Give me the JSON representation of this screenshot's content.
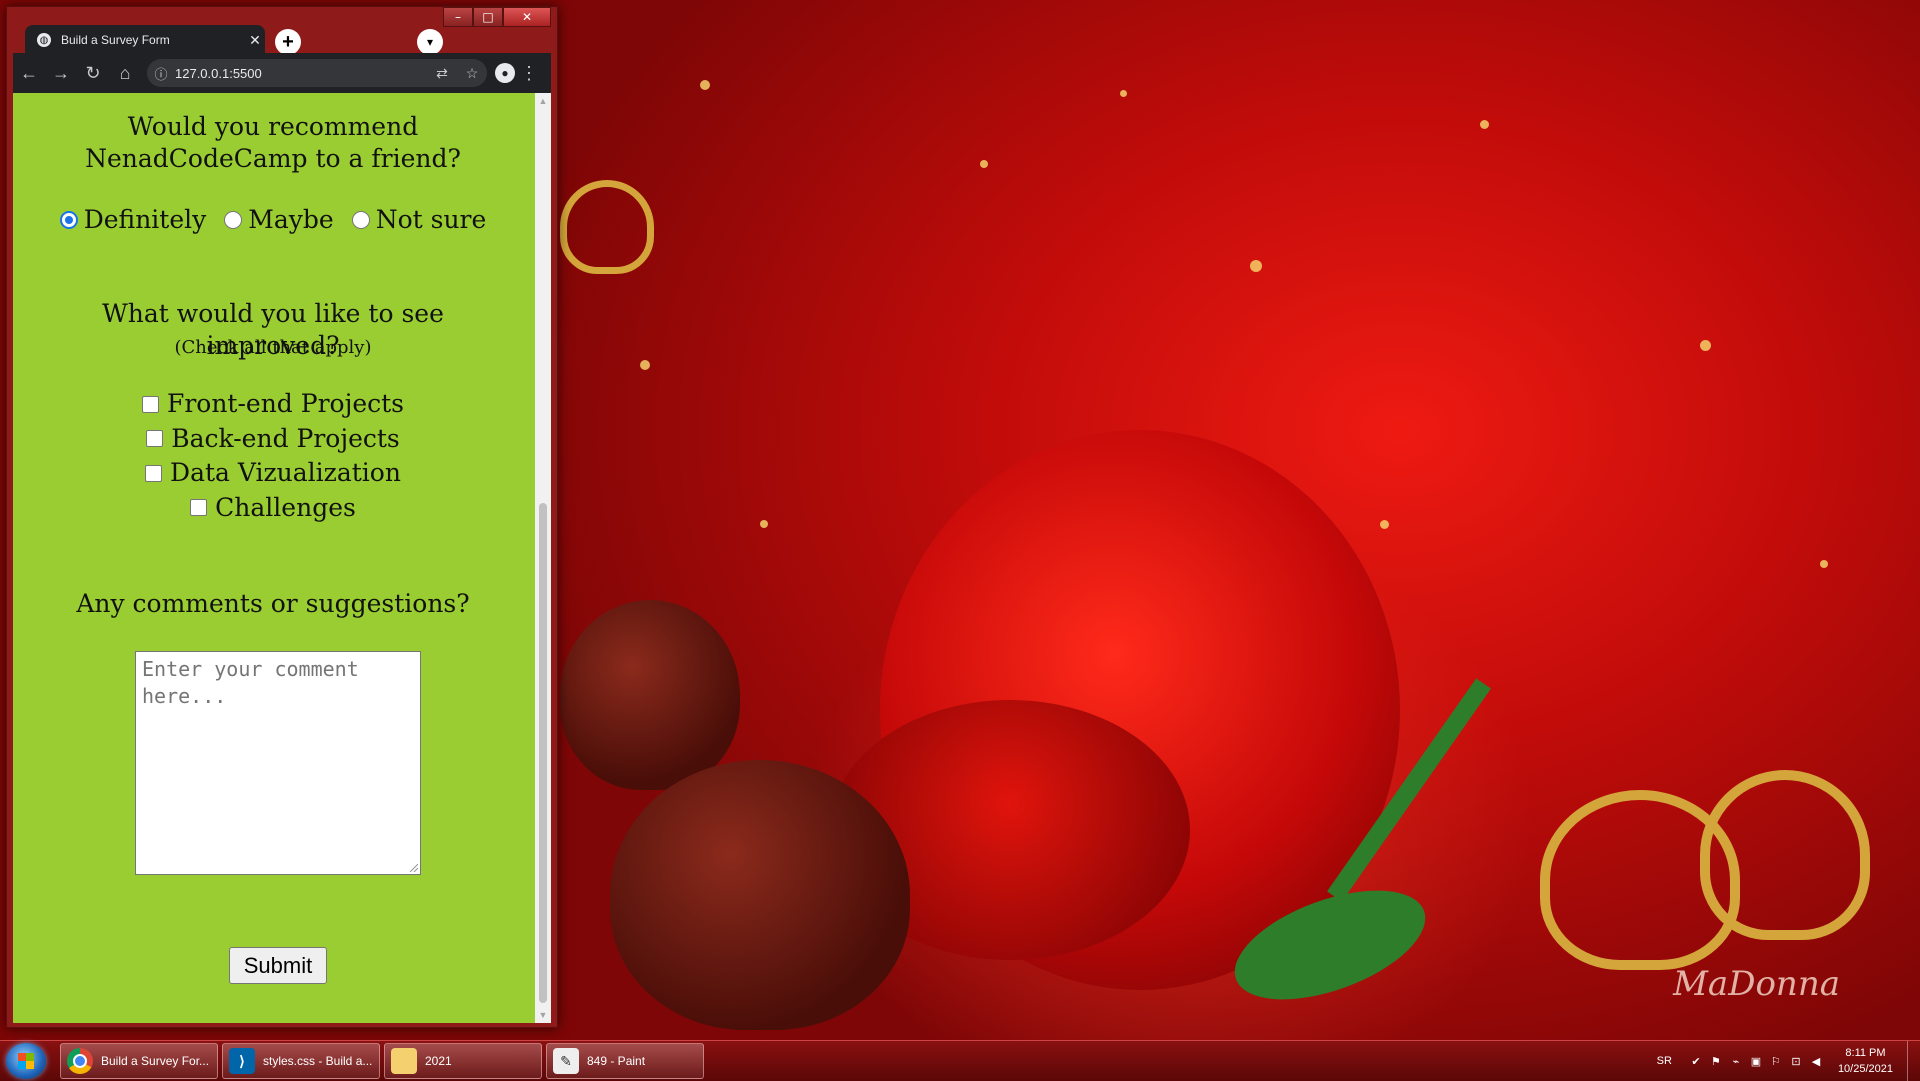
{
  "browser": {
    "tab_title": "Build a Survey Form",
    "url": "127.0.0.1:5500",
    "window_controls": [
      "minimize-icon",
      "maximize-icon",
      "close-icon"
    ]
  },
  "survey": {
    "q1": "Would you recommend NenadCodeCamp to a friend?",
    "radio_options": [
      {
        "label": "Definitely",
        "checked": true
      },
      {
        "label": "Maybe",
        "checked": false
      },
      {
        "label": "Not sure",
        "checked": false
      }
    ],
    "q2": "What would you like to see improved?",
    "q2_hint": "(Check all that apply)",
    "checkbox_options": [
      {
        "label": "Front-end Projects",
        "checked": false
      },
      {
        "label": "Back-end Projects",
        "checked": false
      },
      {
        "label": "Data Vizualization",
        "checked": false
      },
      {
        "label": "Challenges",
        "checked": false
      }
    ],
    "q3": "Any comments or suggestions?",
    "comment_placeholder": "Enter your comment here...",
    "submit_label": "Submit"
  },
  "colors": {
    "page_background": "#9acd32",
    "browser_frame": "#8f1a1a",
    "taskbar": "#5c0707"
  },
  "wallpaper": {
    "signature": "MaDonna"
  },
  "taskbar": {
    "items": [
      {
        "label": "Build a Survey For...",
        "icon": "chrome-icon"
      },
      {
        "label": "styles.css - Build a...",
        "icon": "vscode-icon"
      },
      {
        "label": "2021",
        "icon": "folder-icon"
      },
      {
        "label": "849 - Paint",
        "icon": "paint-icon"
      }
    ],
    "language": "SR",
    "time": "8:11 PM",
    "date": "10/25/2021"
  }
}
